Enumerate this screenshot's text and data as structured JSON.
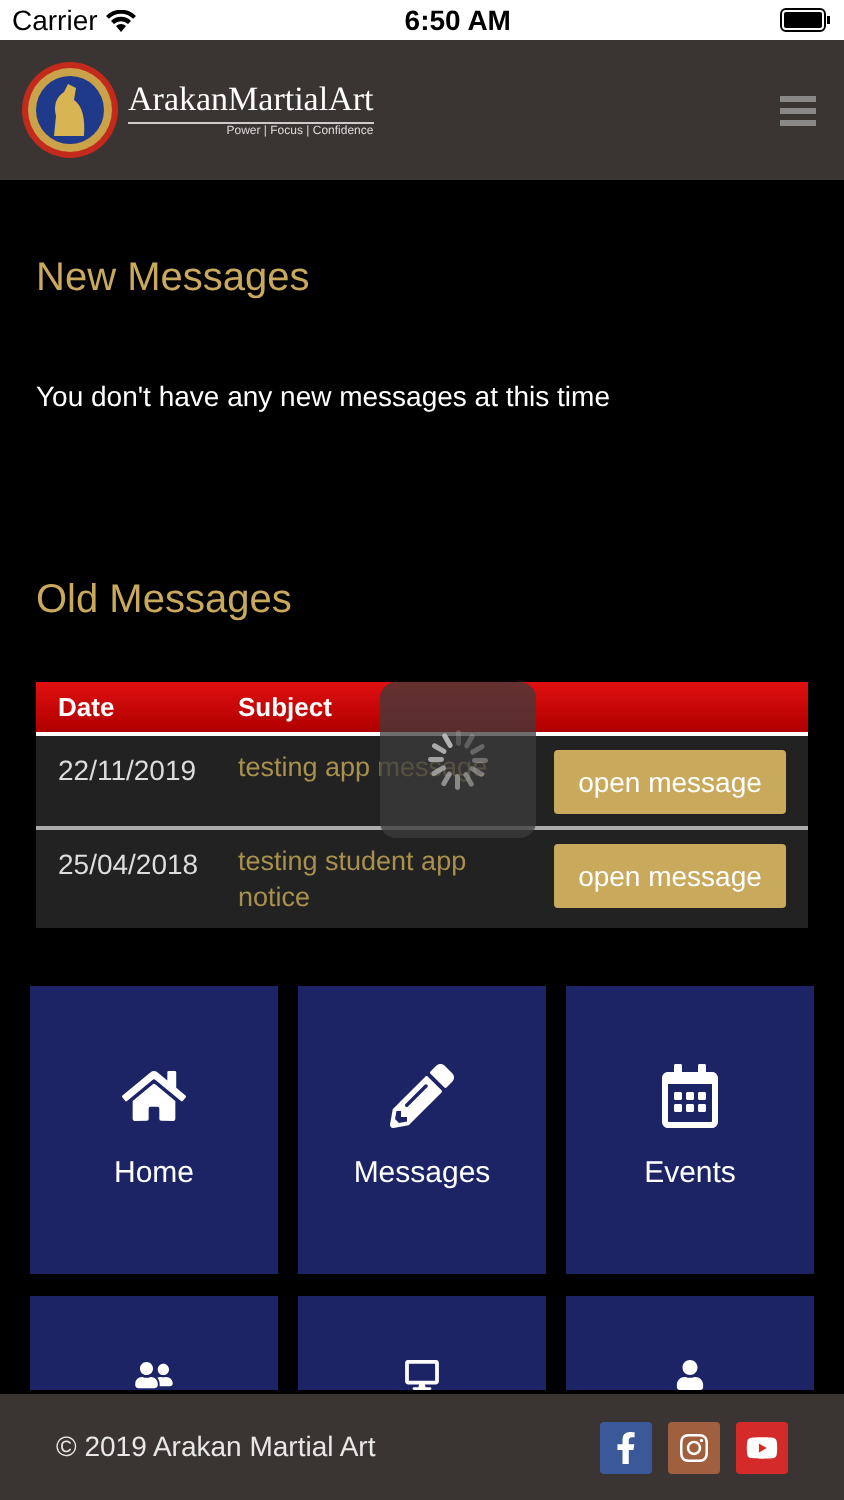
{
  "status_bar": {
    "carrier": "Carrier",
    "time": "6:50 AM"
  },
  "header": {
    "brand": "ArakanMartialArt",
    "tagline": "Power | Focus | Confidence"
  },
  "new_messages": {
    "title": "New Messages",
    "text": "You don't have any new messages at this time"
  },
  "old_messages": {
    "title": "Old Messages",
    "loading": true,
    "columns": [
      "Date",
      "Subject"
    ],
    "rows": [
      {
        "date": "22/11/2019",
        "subject": "testing app message",
        "action": "open message"
      },
      {
        "date": "25/04/2018",
        "subject": "testing student app notice",
        "action": "open message"
      }
    ]
  },
  "tiles": [
    {
      "kind": "home",
      "label": "Home"
    },
    {
      "kind": "pencil",
      "label": "Messages"
    },
    {
      "kind": "calendar",
      "label": "Events"
    },
    {
      "kind": "users"
    },
    {
      "kind": "screen"
    },
    {
      "kind": "person"
    }
  ],
  "footer": {
    "copyright": "© 2019 Arakan Martial Art",
    "social": [
      {
        "kind": "facebook",
        "color": "#3b5998"
      },
      {
        "kind": "instagram",
        "color": "#a0603f"
      },
      {
        "kind": "youtube",
        "color": "#d42a2a"
      }
    ]
  }
}
